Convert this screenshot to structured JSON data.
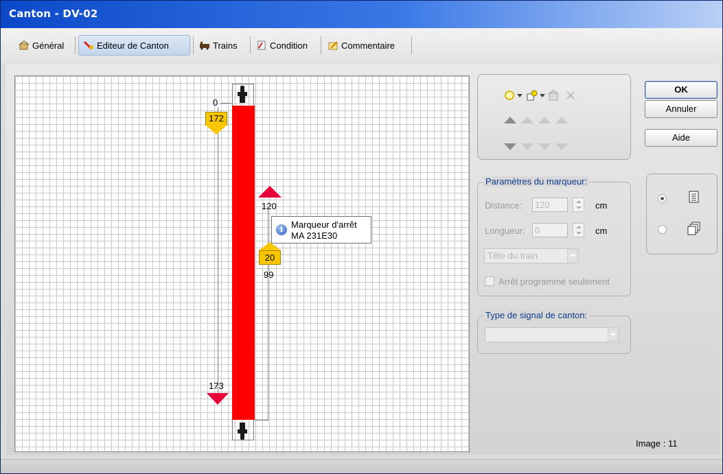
{
  "window": {
    "title": "Canton - DV-02"
  },
  "tabs": [
    {
      "label": "Général"
    },
    {
      "label": "Editeur de Canton",
      "active": true
    },
    {
      "label": "Trains"
    },
    {
      "label": "Condition"
    },
    {
      "label": "Commentaire"
    }
  ],
  "editor": {
    "top_label": "0",
    "left_top_marker": "172",
    "left_bottom_label": "173",
    "right_top_label": "120",
    "right_marker": "20",
    "right_bottom_label": "99",
    "block_color": "#ff0000",
    "tooltip": {
      "line1": "Marqueur d'arrêt",
      "line2": "MA 231E30"
    }
  },
  "toolbar": {
    "icons": [
      "circle-tool-icon",
      "dropdown-arrow-icon",
      "shapes-tool-icon",
      "dropdown-arrow-icon",
      "properties-icon",
      "delete-x-icon"
    ]
  },
  "marker_params": {
    "title": "Paramètres du marqueur:",
    "distance_label": "Distance:",
    "distance_value": "120",
    "distance_unit": "cm",
    "length_label": "Longueur:",
    "length_value": "0",
    "length_unit": "cm",
    "position_select": "Tête du train",
    "scheduled_stop_label": "Arrêt programmé seulement"
  },
  "signal_type": {
    "title": "Type de signal de canton:",
    "value": ""
  },
  "buttons": {
    "ok": "OK",
    "cancel": "Annuler",
    "help": "Aide"
  },
  "view_options": {
    "selected": 0
  },
  "status": {
    "image": "Image : 11"
  }
}
